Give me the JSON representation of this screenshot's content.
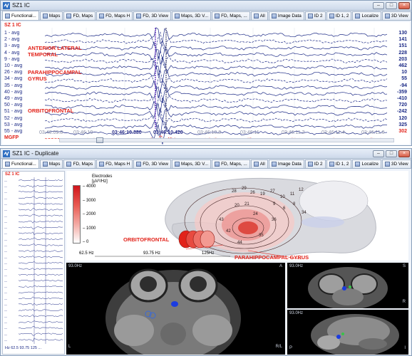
{
  "top_window": {
    "title": "SZ1 IC",
    "tabs": [
      "Functional...",
      "Maps",
      "FD, Maps",
      "FD, Maps H",
      "FD, 3D View",
      "Maps, 3D V...",
      "FD, Maps, ...",
      "All",
      "Image Data",
      "ID 2",
      "ID 1, 2",
      "Localize",
      "3D View"
    ],
    "plot_title": "SZ 1 IC",
    "channels": [
      "1 - avg",
      "2 - avg",
      "3 - avg",
      "4 - avg",
      "9 - avg",
      "10 - avg",
      "26 - avg",
      "34 - avg",
      "35 - avg",
      "40 - avg",
      "49 - avg",
      "50 - avg",
      "51 - avg",
      "52 - avg",
      "53 - avg",
      "55 - avg",
      "MGFP"
    ],
    "values": [
      "130",
      "141",
      "151",
      "228",
      "203",
      "462",
      "10",
      "55",
      "-94",
      "-359",
      "-410",
      "720",
      "-242",
      "120",
      "325",
      "302"
    ],
    "annotations": [
      "ANTERIOR LATERAL",
      "TEMPORAL",
      "PARAHIPPOCAMPAL",
      "GYRUS",
      "ORBITOFRONTAL"
    ],
    "times": [
      "03:46:09.8",
      "03:46:10",
      "03:46:10.380",
      "03:46:10.420",
      "03:46:10.8",
      "03:46:11",
      "03:46:11.2",
      "03:46:11.4",
      "03:46:11.6"
    ]
  },
  "bottom_window": {
    "title": "SZ1 IC - Duplicate",
    "tabs": [
      "Functional...",
      "Maps",
      "FD, Maps",
      "FD, Maps H",
      "FD, 3D View",
      "Maps, 3D V...",
      "FD, Maps, ...",
      "All",
      "Image Data",
      "ID 2",
      "ID 1, 2",
      "Localize",
      "3D View"
    ],
    "mini_title": "SZ 1 IC",
    "mini_footer": "Hz 62.5 93.75 125 ...",
    "colorbar": {
      "title": "Electrodes",
      "units": "[µV²/Hz]",
      "ticks": [
        "4000",
        "3000",
        "2000",
        "1000",
        "0"
      ]
    },
    "freq_labels": [
      "62.5 Hz",
      "93.75 Hz",
      "125Hz"
    ],
    "brain_annotations": [
      "ORBITOFRONTAL",
      "PARAHIPPOCAMPAL GYRUS"
    ],
    "electrode_numbers": [
      "28",
      "29",
      "26",
      "19",
      "27",
      "10",
      "11",
      "12",
      "9",
      "6",
      "20",
      "21",
      "8",
      "24",
      "34",
      "36",
      "35",
      "42",
      "43",
      "44"
    ],
    "mri": {
      "main_header": "93.0Hz",
      "right_top_header": "93.0Hz",
      "right_bottom_header": "93.0Hz",
      "orientation": [
        "L",
        "R",
        "A",
        "P",
        "S",
        "I"
      ],
      "footer": "R/L"
    }
  },
  "colors": {
    "trace": "#1c2a86",
    "annotation": "#e2231a",
    "cursor": "#6b3ac2"
  }
}
